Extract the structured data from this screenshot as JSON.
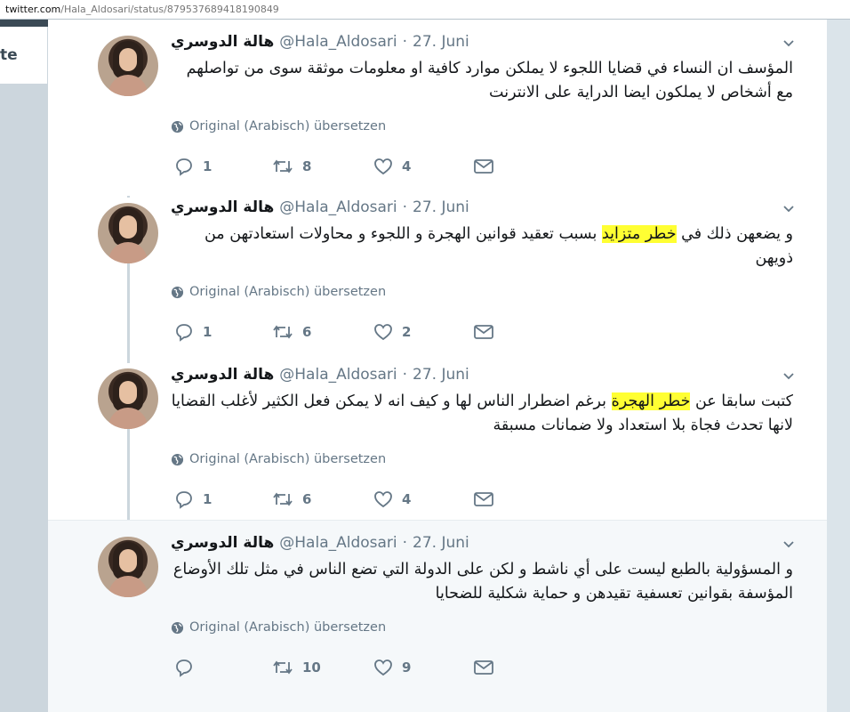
{
  "browser": {
    "url_host": "twitter.com",
    "url_path": "/Hala_Aldosari/status/879537689418190849"
  },
  "left_panel": {
    "fragment": "te"
  },
  "tweets": [
    {
      "name": "هالة الدوسري",
      "handle": "@Hala_Aldosari",
      "sep": "·",
      "date": "27. Juni",
      "text_before": "المؤسف ان النساء في قضايا اللجوء لا يملكن موارد كافية او معلومات موثقة سوى من تواصلهم مع أشخاص لا يملكون ايضا الدراية على الانترنت",
      "highlight": "",
      "text_after": "",
      "translate": "Original (Arabisch) übersetzen",
      "replies": "1",
      "retweets": "8",
      "likes": "4"
    },
    {
      "name": "هالة الدوسري",
      "handle": "@Hala_Aldosari",
      "sep": "·",
      "date": "27. Juni",
      "text_before": "و يضعهن ذلك في ",
      "highlight": "خطر متزايد",
      "text_after": " بسبب تعقيد قوانين الهجرة و اللجوء و محاولات استعادتهن من ذويهن",
      "translate": "Original (Arabisch) übersetzen",
      "replies": "1",
      "retweets": "6",
      "likes": "2"
    },
    {
      "name": "هالة الدوسري",
      "handle": "@Hala_Aldosari",
      "sep": "·",
      "date": "27. Juni",
      "text_before": "كتبت سابقا عن ",
      "highlight": "خطر الهجرة",
      "text_after": " برغم اضطرار الناس لها و كيف انه لا يمكن فعل الكثير لأغلب القضايا لانها تحدث فجاة بلا استعداد ولا ضمانات مسبقة",
      "translate": "Original (Arabisch) übersetzen",
      "replies": "1",
      "retweets": "6",
      "likes": "4"
    },
    {
      "name": "هالة الدوسري",
      "handle": "@Hala_Aldosari",
      "sep": "·",
      "date": "27. Juni",
      "text_before": "و المسؤولية بالطبع ليست على أي ناشط و لكن على الدولة التي تضع الناس في مثل تلك الأوضاع المؤسفة بقوانين تعسفية تقيدهن و حماية شكلية للضحايا",
      "highlight": "",
      "text_after": "",
      "translate": "Original (Arabisch) übersetzen",
      "replies": "",
      "retweets": "10",
      "likes": "9"
    }
  ],
  "colors": {
    "accent_gray": "#657786",
    "highlight": "#ffff33",
    "thread_line": "#ccd6dd"
  },
  "icons": [
    "globe-icon",
    "reply-icon",
    "retweet-icon",
    "like-icon",
    "dm-icon",
    "chevron-down-icon"
  ]
}
